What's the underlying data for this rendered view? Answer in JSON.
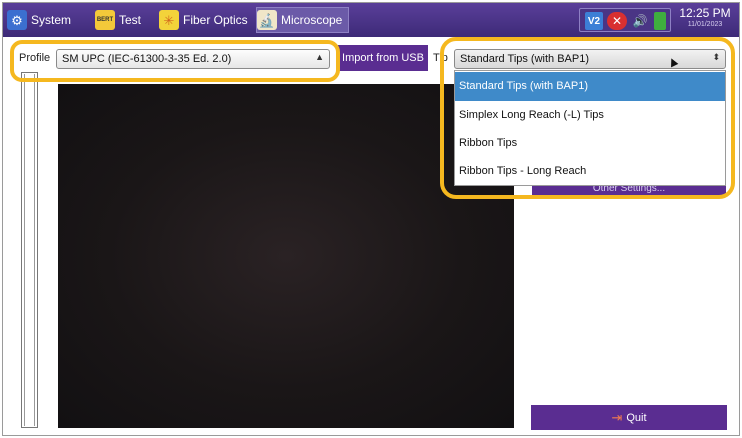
{
  "topbar": {
    "tabs": [
      {
        "label": "System",
        "icon": "gear-icon"
      },
      {
        "label": "Test",
        "icon": "bert-icon",
        "icon_text": "BERT"
      },
      {
        "label": "Fiber Optics",
        "icon": "laser-icon"
      },
      {
        "label": "Microscope",
        "icon": "microscope-icon"
      }
    ],
    "active_tab": "Microscope",
    "tray": {
      "v2": "V2",
      "close_icon": "close-icon",
      "speaker_icon": "speaker-icon",
      "battery_icon": "battery-icon"
    },
    "clock": {
      "time": "12:25 PM",
      "date": "11/01/2023"
    }
  },
  "profile": {
    "label": "Profile",
    "value": "SM UPC (IEC-61300-3-35 Ed. 2.0)"
  },
  "import_button": {
    "label": "Import from USB"
  },
  "tip": {
    "label": "Tip",
    "value": "Standard Tips (with BAP1)",
    "options": [
      "Standard Tips (with BAP1)",
      "Simplex Long Reach (-L) Tips",
      "Ribbon Tips",
      "Ribbon Tips - Long Reach"
    ],
    "selected_index": 0
  },
  "partial_button": {
    "label": "Other Settings..."
  },
  "quit_button": {
    "label": "Quit"
  },
  "colors": {
    "topbar": "#3d2a77",
    "button_purple": "#5a2d91",
    "selection_blue": "#3f8ac9",
    "highlight": "#f5b81f"
  }
}
